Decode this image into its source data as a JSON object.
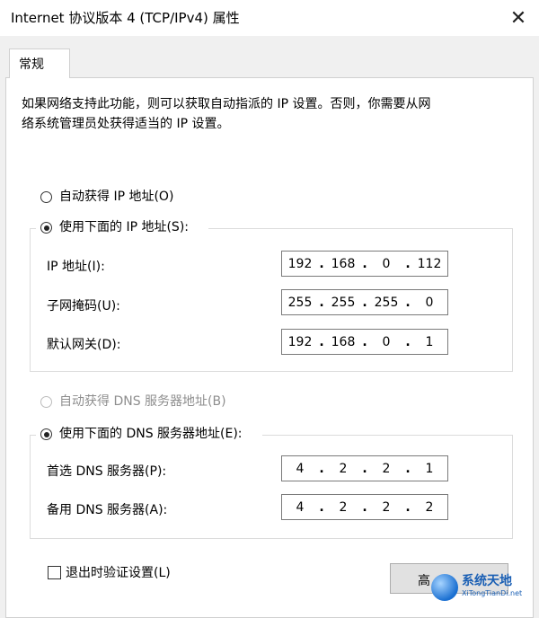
{
  "window": {
    "title": "Internet 协议版本 4 (TCP/IPv4) 属性",
    "close_glyph": "✕"
  },
  "tabs": [
    {
      "label": "常规"
    }
  ],
  "description_line1": "如果网络支持此功能，则可以获取自动指派的 IP 设置。否则，你需要从网",
  "description_line2": "络系统管理员处获得适当的 IP 设置。",
  "ip_section": {
    "auto_label": "自动获得 IP 地址(O)",
    "manual_label": "使用下面的 IP 地址(S):",
    "selected": "manual",
    "fields": [
      {
        "label": "IP 地址(I):",
        "octets": [
          "192",
          "168",
          "0",
          "112"
        ]
      },
      {
        "label": "子网掩码(U):",
        "octets": [
          "255",
          "255",
          "255",
          "0"
        ]
      },
      {
        "label": "默认网关(D):",
        "octets": [
          "192",
          "168",
          "0",
          "1"
        ]
      }
    ]
  },
  "dns_section": {
    "auto_label": "自动获得 DNS 服务器地址(B)",
    "manual_label": "使用下面的 DNS 服务器地址(E):",
    "selected": "manual",
    "auto_disabled": true,
    "fields": [
      {
        "label": "首选 DNS 服务器(P):",
        "octets": [
          "4",
          "2",
          "2",
          "1"
        ]
      },
      {
        "label": "备用 DNS 服务器(A):",
        "octets": [
          "4",
          "2",
          "2",
          "2"
        ]
      }
    ]
  },
  "validate_label": "退出时验证设置(L)",
  "validate_checked": false,
  "advanced_button_label": "高",
  "watermark": {
    "main": "系统天地",
    "sub": "XiTongTianDi.net"
  },
  "colors": {
    "accent": "#1a5fb4",
    "disabled_text": "#8e8e8e"
  }
}
